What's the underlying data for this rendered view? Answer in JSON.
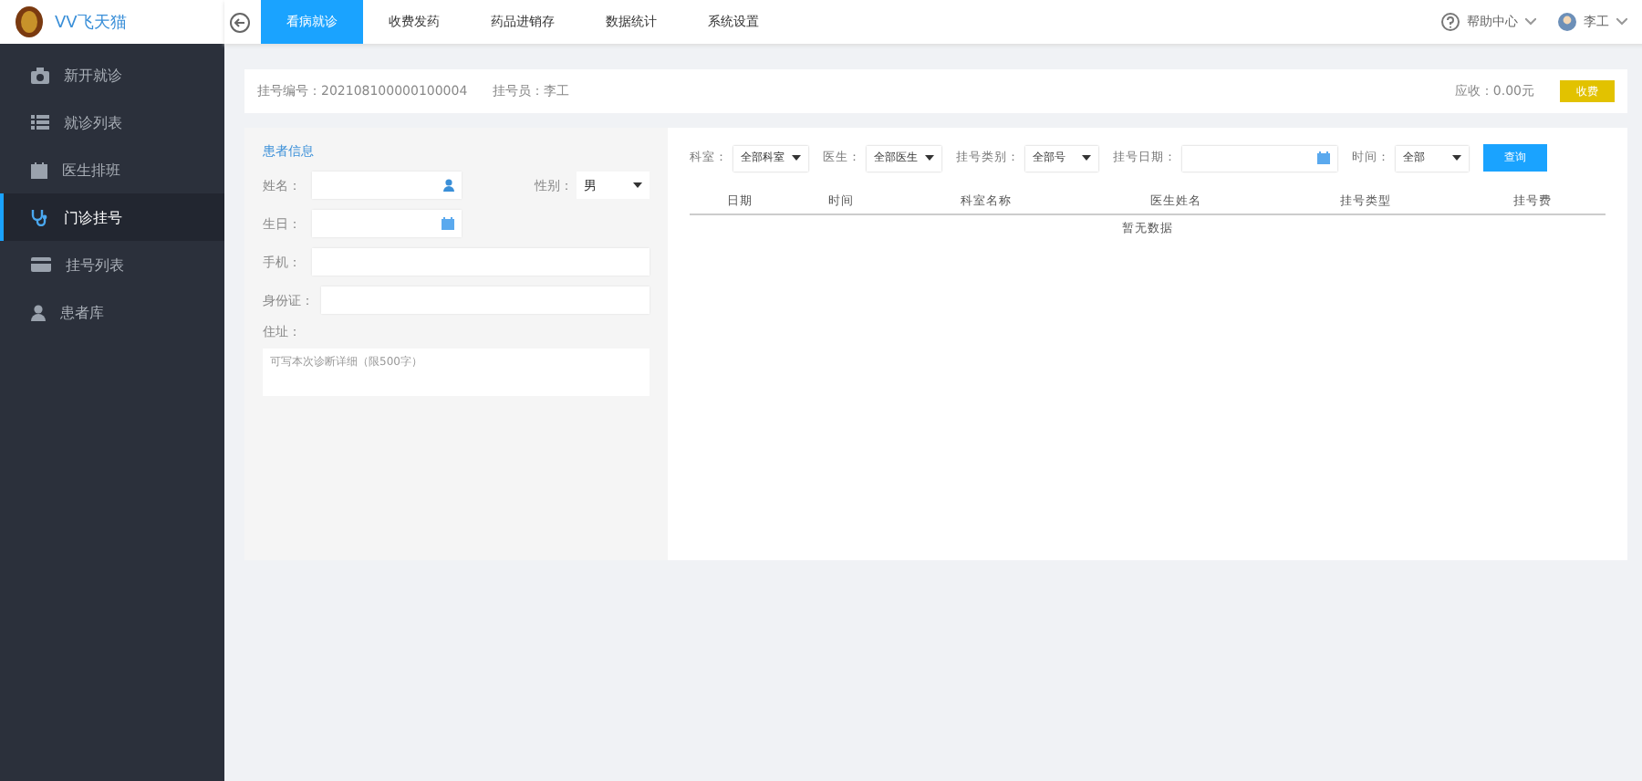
{
  "logo": {
    "text": "VV飞天猫"
  },
  "top_nav": {
    "tabs": [
      {
        "label": "看病就诊",
        "selected": true
      },
      {
        "label": "收费发药",
        "selected": false
      },
      {
        "label": "药品进销存",
        "selected": false
      },
      {
        "label": "数据统计",
        "selected": false
      },
      {
        "label": "系统设置",
        "selected": false
      }
    ],
    "help": "帮助中心",
    "user": "李工"
  },
  "sidebar": {
    "items": [
      {
        "label": "新开就诊",
        "selected": false
      },
      {
        "label": "就诊列表",
        "selected": false
      },
      {
        "label": "医生排班",
        "selected": false
      },
      {
        "label": "门诊挂号",
        "selected": true
      },
      {
        "label": "挂号列表",
        "selected": false
      },
      {
        "label": "患者库",
        "selected": false
      }
    ]
  },
  "info_bar": {
    "register_no": "挂号编号：202108100000100004",
    "registrar": "挂号员：李工",
    "due": "应收：0.00元",
    "charge_button": "收费"
  },
  "patient_form": {
    "title": "患者信息",
    "name_label": "姓名：",
    "gender_label": "性别：",
    "gender_value": "男",
    "birthday_label": "生日：",
    "phone_label": "手机：",
    "id_label": "身份证：",
    "address_label": "住址：",
    "address_placeholder": "可写本次诊断详细（限500字）"
  },
  "filters": [
    {
      "label": "科室：",
      "value": "全部科室",
      "kind": "select"
    },
    {
      "label": "医生：",
      "value": "全部医生",
      "kind": "select"
    },
    {
      "label": "挂号类别：",
      "value": "全部号",
      "kind": "select"
    },
    {
      "label": "挂号日期：",
      "kind": "date"
    },
    {
      "label": "时间：",
      "value": "全部",
      "kind": "select"
    }
  ],
  "query_button": "查询",
  "table": {
    "columns": [
      "日期",
      "时间",
      "科室名称",
      "医生姓名",
      "挂号类型",
      "挂号费"
    ],
    "empty_text": "暂无数据"
  }
}
